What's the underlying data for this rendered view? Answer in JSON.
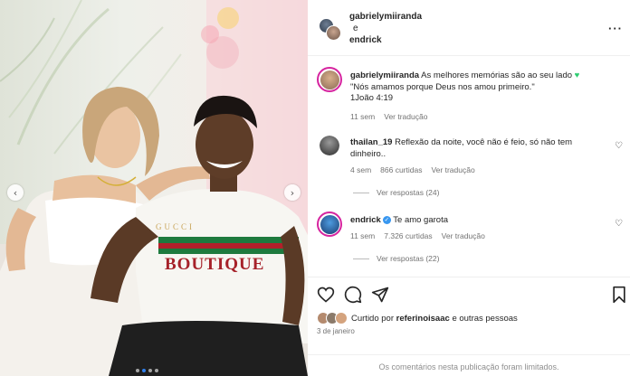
{
  "post": {
    "author": "gabrielymiiranda",
    "connector": "e",
    "coauthor": "endrick",
    "more_icon": "more-horizontal-icon"
  },
  "caption": {
    "user": "gabrielymiiranda",
    "text": "As melhores memórias são ao seu lado",
    "emoji": "♥",
    "quote": "\"Nós amamos porque Deus nos amou primeiro.\"",
    "ref": "1João 4:19",
    "time": "11 sem",
    "translate": "Ver tradução"
  },
  "comments": [
    {
      "user": "thailan_19",
      "text": "Reflexão da noite, você não é feio, só não tem dinheiro..",
      "time": "4 sem",
      "likes": "866 curtidas",
      "translate": "Ver tradução",
      "replies": "Ver respostas (24)"
    },
    {
      "user": "endrick",
      "text": "Te amo garota",
      "time": "11 sem",
      "likes": "7.326 curtidas",
      "translate": "Ver tradução",
      "replies": "Ver respostas (22)"
    }
  ],
  "likes_line": {
    "prefix": "Curtido por",
    "user": "referinoisaac",
    "suffix": "e outras pessoas"
  },
  "date": "3 de janeiro",
  "limited": "Os comentários nesta publicação foram limitados.",
  "photo": {
    "shirt_text": "BOUTIQUE",
    "shirt_brand": "GUCCI"
  },
  "colors": {
    "story_ring": "#d6249f",
    "verified": "#3897f0",
    "green_heart": "#2ecc71",
    "muted": "#737373"
  }
}
